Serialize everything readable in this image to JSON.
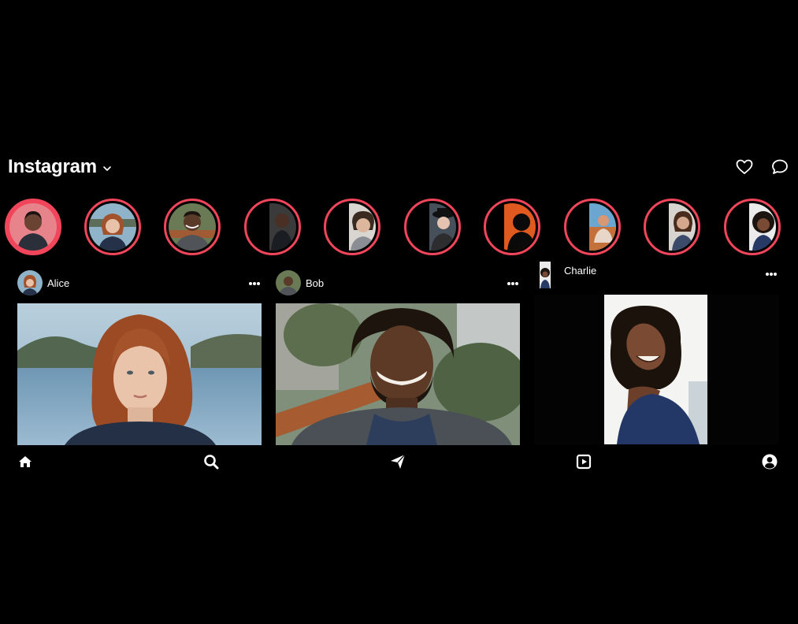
{
  "app": {
    "title": "Instagram"
  },
  "stories": [
    {
      "active": true
    },
    {
      "active": false
    },
    {
      "active": false
    },
    {
      "active": false
    },
    {
      "active": false
    },
    {
      "active": false
    },
    {
      "active": false
    },
    {
      "active": false
    },
    {
      "active": false
    },
    {
      "active": false
    }
  ],
  "posts": [
    {
      "username": "Alice"
    },
    {
      "username": "Bob"
    },
    {
      "username": "Charlie"
    }
  ],
  "colors": {
    "story_ring": "#f0455a",
    "background": "#000000",
    "text": "#ffffff"
  },
  "icons": {
    "header": [
      "chevron-down-icon",
      "heart-icon",
      "message-bubble-icon"
    ],
    "nav": [
      "home-icon",
      "search-icon",
      "send-icon",
      "reels-icon",
      "profile-icon"
    ]
  }
}
